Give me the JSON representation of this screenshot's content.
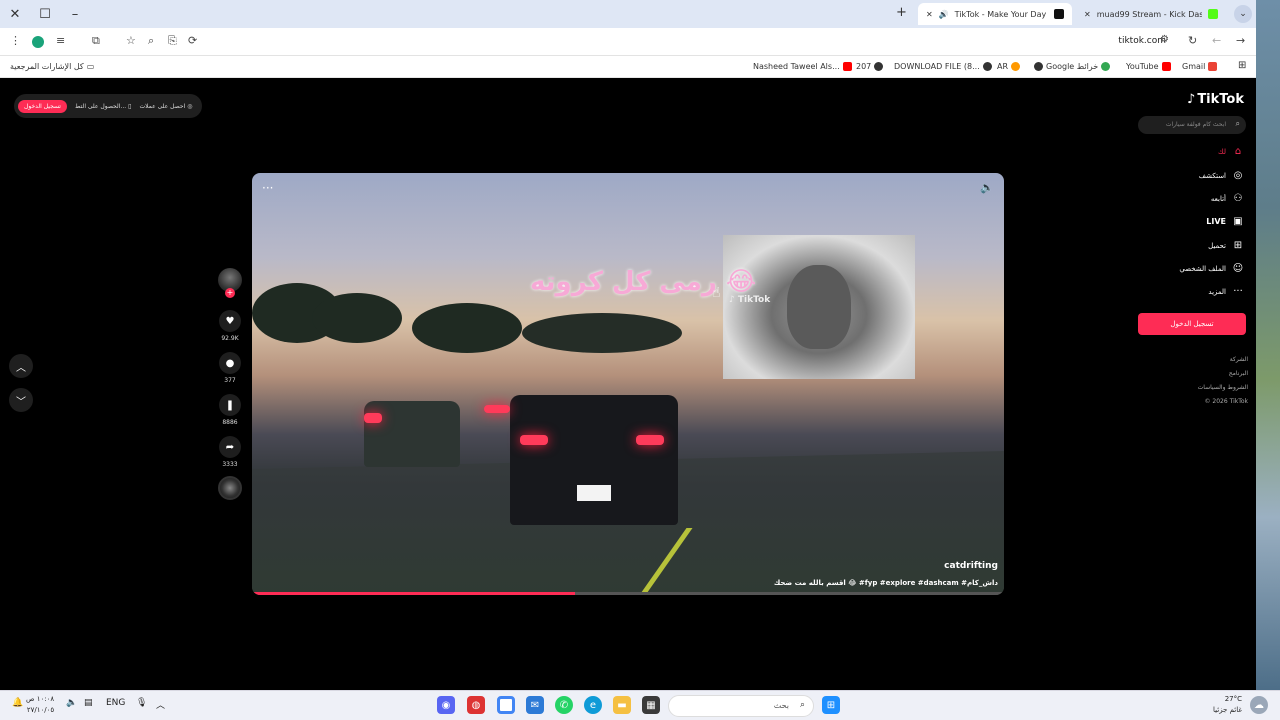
{
  "browser": {
    "tabs": [
      {
        "title": "TikTok - Make Your Day"
      },
      {
        "title": "muad99 Stream - Kick Dashboard"
      }
    ],
    "url": "tiktok.com",
    "bookmarks_folder": "كل الإشارات المرجعية",
    "bookmarks": [
      "Nasheed Taweel Als...",
      "207",
      "DOWNLOAD FILE (8...",
      "AR",
      "Google خرائط",
      "YouTube",
      "Gmail"
    ]
  },
  "tiktok": {
    "logo": "TikTok",
    "search_placeholder": "ابحث كام فولفة سيارات",
    "nav": [
      {
        "label": "لك",
        "icon": "home-icon"
      },
      {
        "label": "استكشف",
        "icon": "compass-icon"
      },
      {
        "label": "أتابعه",
        "icon": "following-icon"
      },
      {
        "label": "LIVE",
        "icon": "live-icon"
      },
      {
        "label": "تحميل",
        "icon": "upload-icon"
      },
      {
        "label": "الملف الشخصي",
        "icon": "profile-icon"
      },
      {
        "label": "المزيد",
        "icon": "more-icon"
      }
    ],
    "login_button": "تسجيل الدخول",
    "footer": [
      "الشركة",
      "البرنامج",
      "الشروط والسياسات",
      "© 2026 TikTok"
    ],
    "topbar": {
      "effects": "احصل على عملات",
      "app": "الحصول على التط...",
      "login": "تسجيل الدخول"
    },
    "video": {
      "overlay_text": "رمى كل كروته 😂",
      "watermark": "TikTok",
      "username": "catdrifting",
      "caption": "اقسم بالله مت ضحك 😂 #fyp #explore #dashcam #داش_كام",
      "progress": 0.43
    },
    "actions": [
      {
        "name": "like",
        "icon": "heart-icon",
        "count": "92.9K"
      },
      {
        "name": "comment",
        "icon": "comment-icon",
        "count": "377"
      },
      {
        "name": "save",
        "icon": "bookmark-icon",
        "count": "8886"
      },
      {
        "name": "share",
        "icon": "share-icon",
        "count": "3333"
      }
    ]
  },
  "taskbar": {
    "search_placeholder": "بحث",
    "language": "ENG",
    "weather_temp": "27°C",
    "weather_desc": "غائم جزئيا",
    "time": "١٠:٠٨ ص",
    "date": "٢٧/١٠/٠٥"
  },
  "colors": {
    "accent": "#fe2c55",
    "tab_strip": "#dfe7f5"
  }
}
